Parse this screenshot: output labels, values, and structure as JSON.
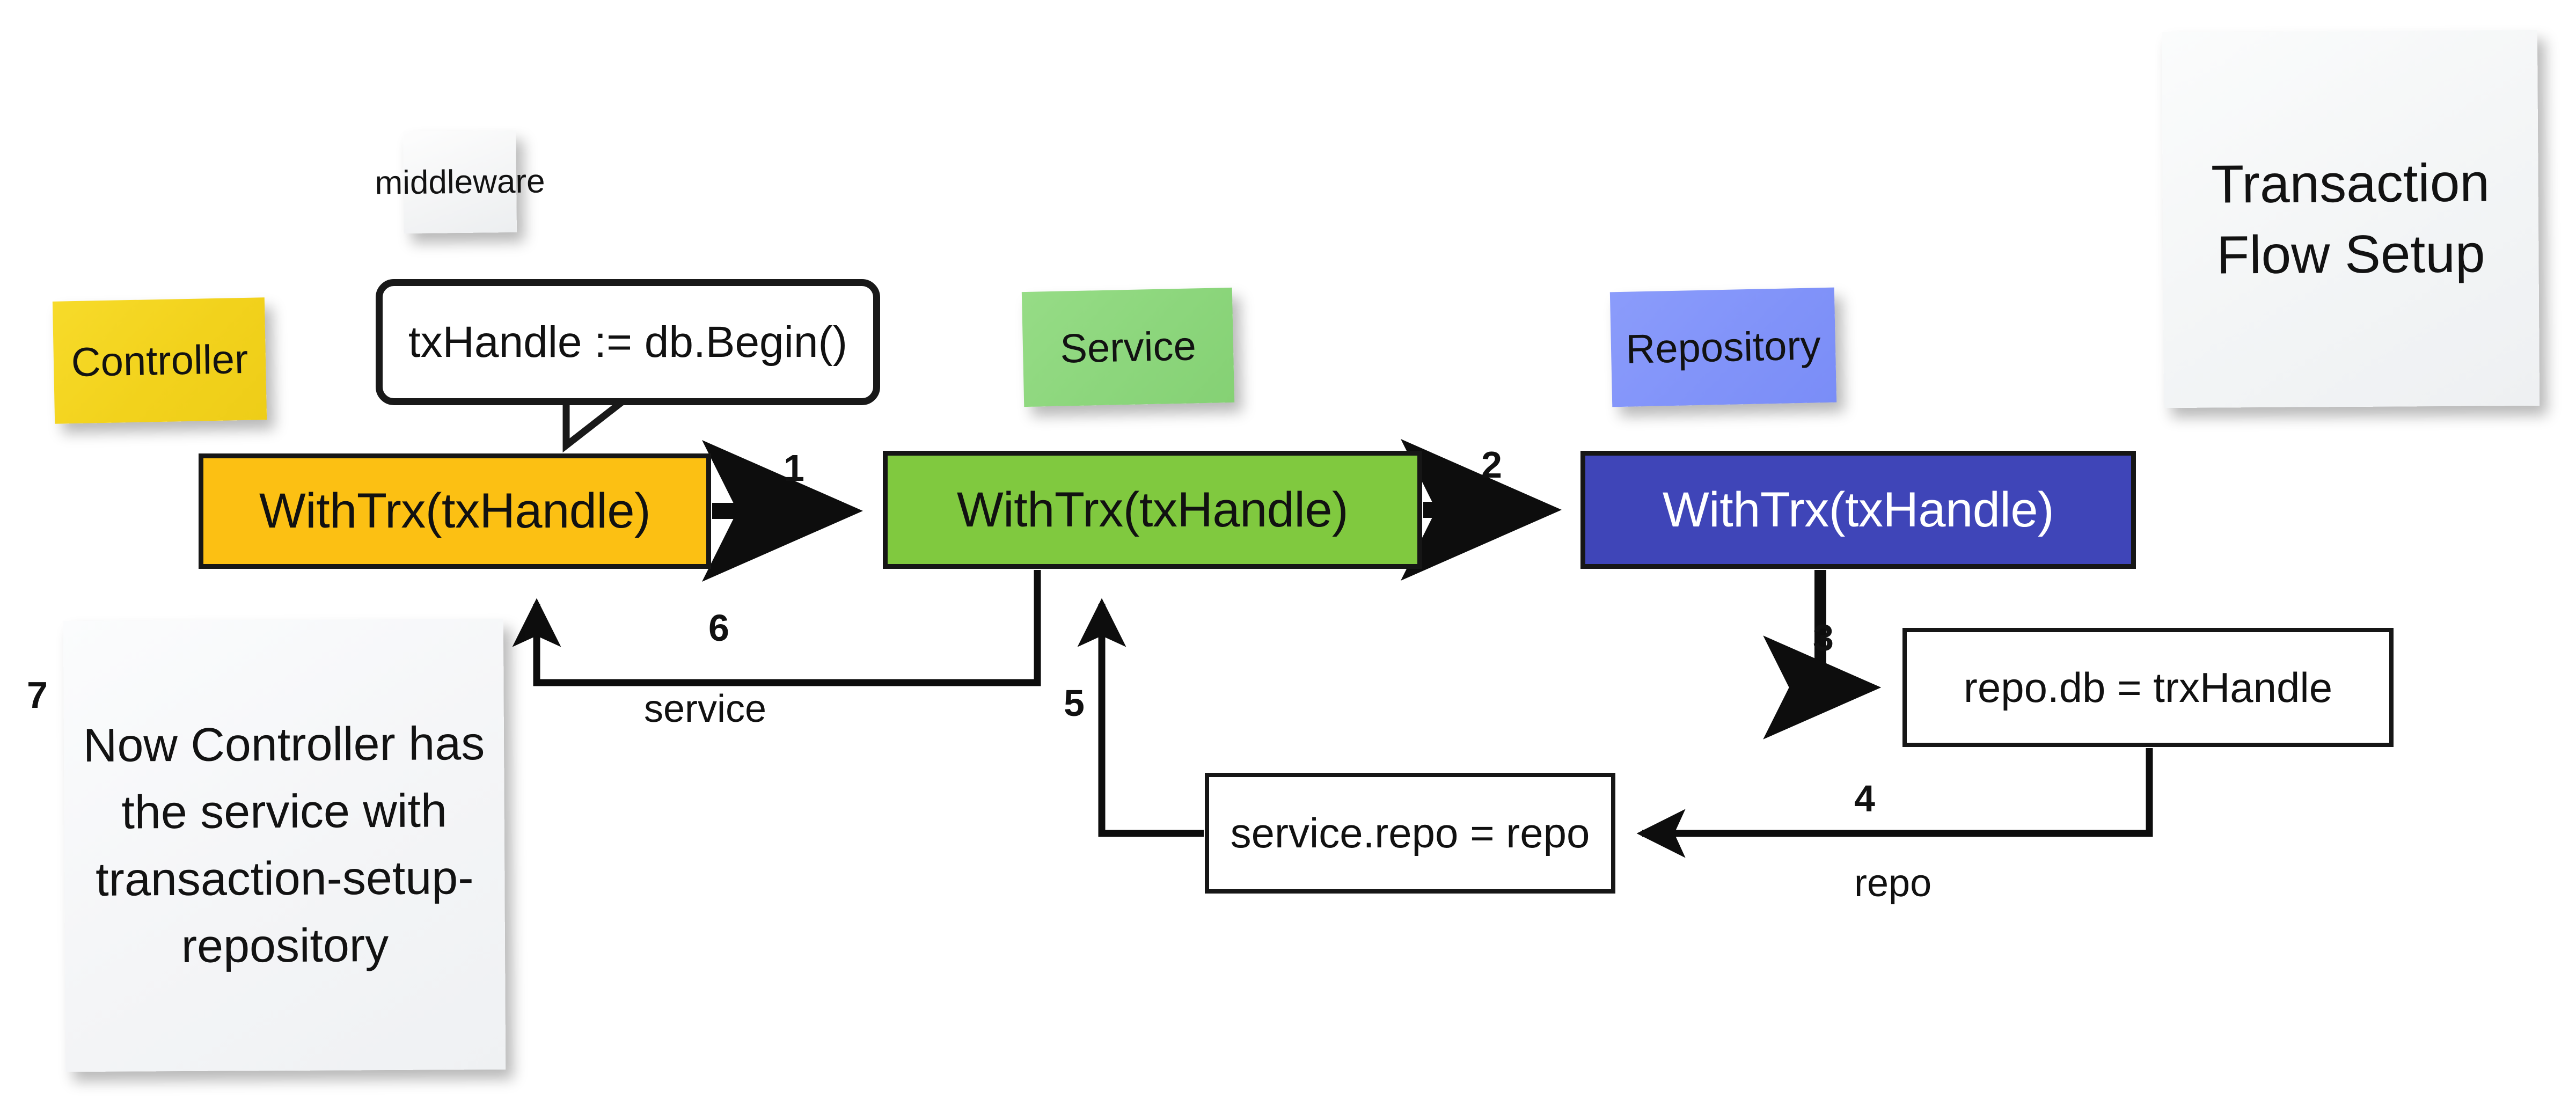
{
  "title_note": {
    "line1": "Transaction",
    "line2": "Flow Setup"
  },
  "sticky_notes": [
    {
      "id": "controller",
      "label": "Controller",
      "color": "#f2d21c"
    },
    {
      "id": "middleware",
      "label": "middleware",
      "color": "#f3f4f5"
    },
    {
      "id": "service",
      "label": "Service",
      "color": "#8cd67c"
    },
    {
      "id": "repository",
      "label": "Repository",
      "color": "#8193f9"
    }
  ],
  "callout": {
    "text": "txHandle := db.Begin()"
  },
  "process_boxes": [
    {
      "id": "controller",
      "label": "WithTrx(txHandle)",
      "fill": "#fcc013",
      "text_color": "#111111"
    },
    {
      "id": "service",
      "label": "WithTrx(txHandle)",
      "fill": "#80c93f",
      "text_color": "#111111"
    },
    {
      "id": "repository",
      "label": "WithTrx(txHandle)",
      "fill": "#3f45b8",
      "text_color": "#ffffff"
    }
  ],
  "assignment_boxes": [
    {
      "id": "repo-db",
      "label": "repo.db = trxHandle"
    },
    {
      "id": "service-repo",
      "label": "service.repo = repo"
    }
  ],
  "edges": [
    {
      "id": "1",
      "number": "1",
      "word": ""
    },
    {
      "id": "2",
      "number": "2",
      "word": ""
    },
    {
      "id": "3",
      "number": "3",
      "word": ""
    },
    {
      "id": "4",
      "number": "4",
      "word": "repo"
    },
    {
      "id": "5",
      "number": "5",
      "word": ""
    },
    {
      "id": "6",
      "number": "6",
      "word": "service"
    },
    {
      "id": "7",
      "number": "7",
      "word": ""
    }
  ],
  "edge_numbers": {
    "one": "1",
    "two": "2",
    "three": "3",
    "four": "4",
    "five": "5",
    "six": "6",
    "seven": "7"
  },
  "edge_words": {
    "service": "service",
    "repo": "repo"
  },
  "final_note": {
    "text": "Now Controller has the service with transaction-setup-repository"
  },
  "colors": {
    "controller": "#fcc013",
    "service": "#80c93f",
    "repository": "#3f45b8",
    "stroke": "#161616",
    "background": "#ffffff"
  }
}
